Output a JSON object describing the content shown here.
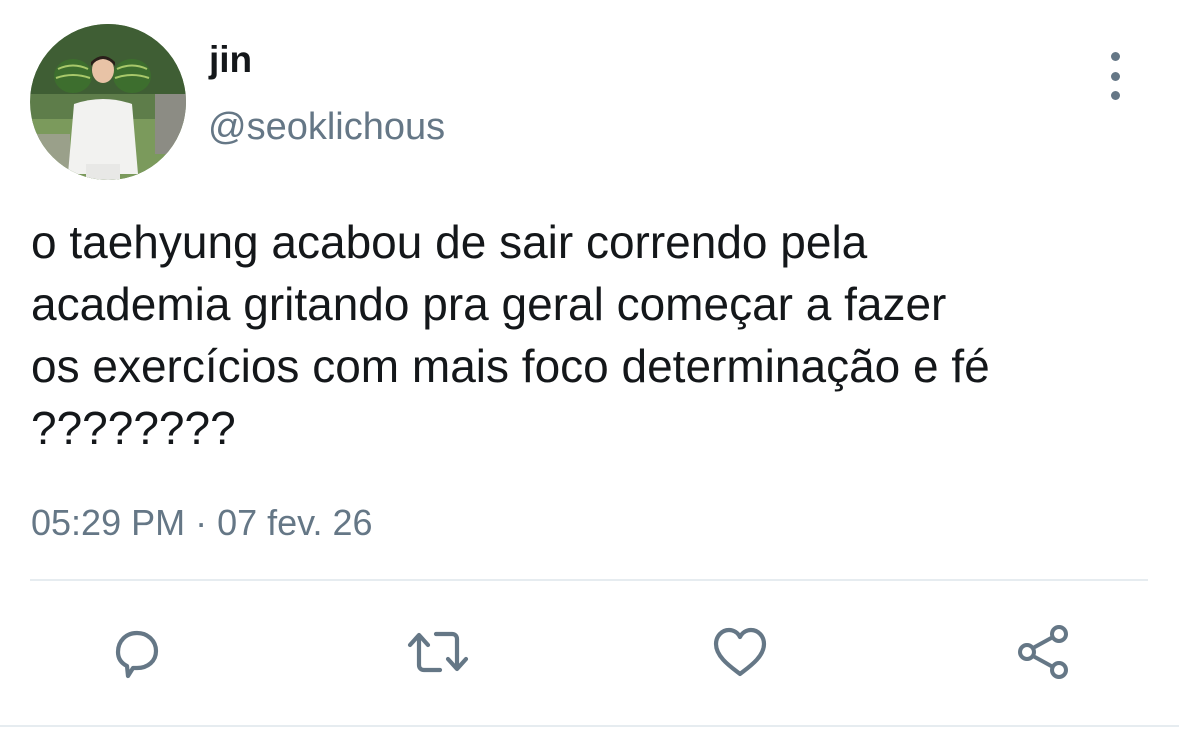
{
  "tweet": {
    "author": {
      "display_name": "jin",
      "handle": "@seoklichous"
    },
    "text": "o taehyung acabou de sair correndo pela\nacademia gritando pra geral começar a fazer\nos exercícios com mais foco determinação e fé\n????????",
    "timestamp": "05:29 PM · 07 fev. 26"
  },
  "actions": {
    "reply_icon": "comment-icon",
    "retweet_icon": "retweet-icon",
    "like_icon": "heart-icon",
    "share_icon": "share-icon"
  },
  "colors": {
    "text_primary": "#14171a",
    "text_secondary": "#657786",
    "divider": "#e6ecf0"
  }
}
